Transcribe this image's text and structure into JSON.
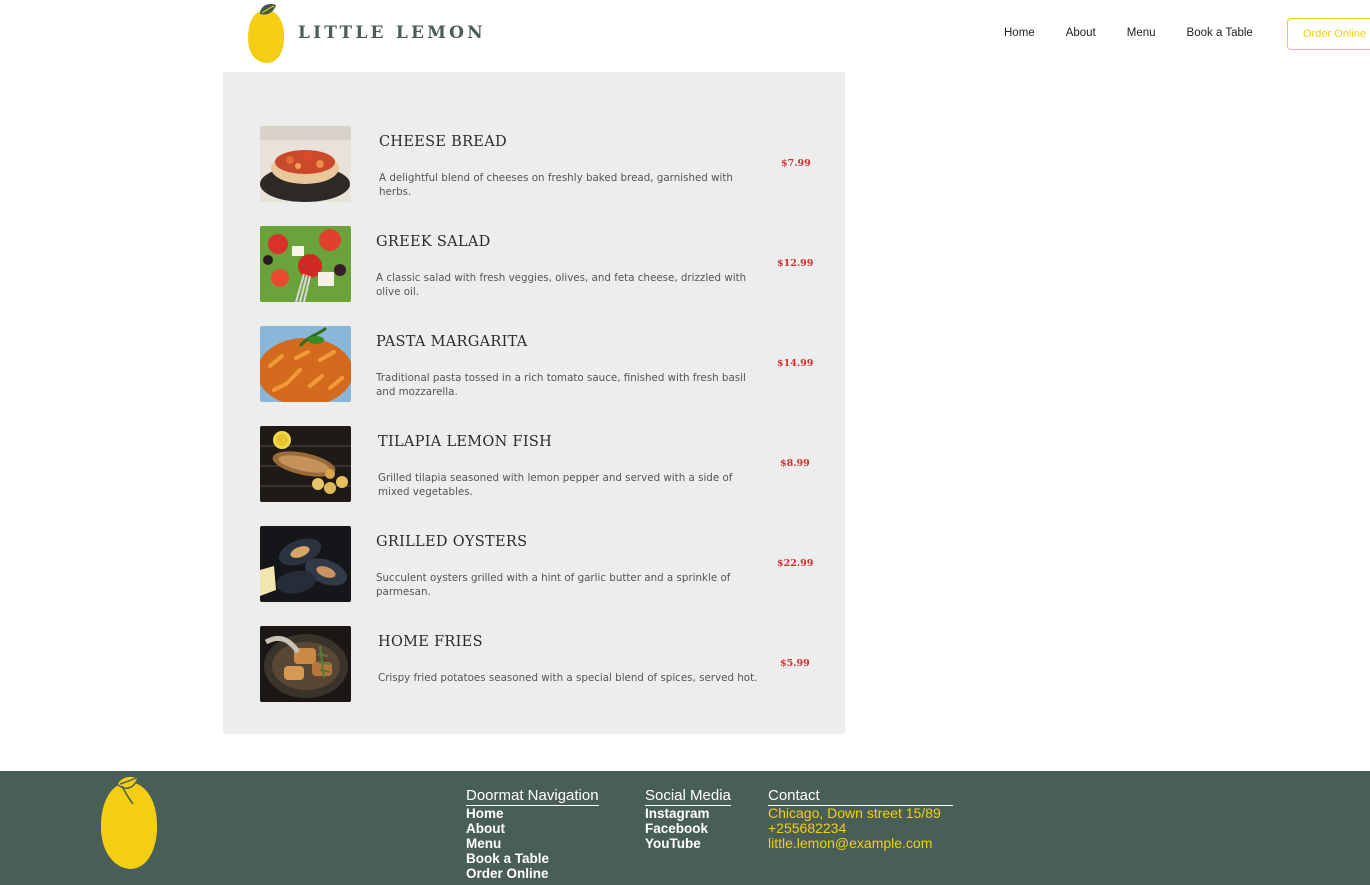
{
  "brand": {
    "name": "LITTLE LEMON",
    "accent": "#F4CE14",
    "primary": "#495E57",
    "price_color": "#D32F2F"
  },
  "nav": {
    "items": [
      "Home",
      "About",
      "Menu",
      "Book a Table"
    ],
    "order_label": "Order Online"
  },
  "menu": {
    "items": [
      {
        "name": "CHEESE BREAD",
        "description": "A delightful blend of cheeses on freshly baked bread, garnished with herbs.",
        "price": "$7.99",
        "image": "cheese-bread-photo"
      },
      {
        "name": "GREEK SALAD",
        "description": "A classic salad with fresh veggies, olives, and feta cheese, drizzled with olive oil.",
        "price": "$12.99",
        "image": "greek-salad-photo"
      },
      {
        "name": "PASTA MARGARITA",
        "description": "Traditional pasta tossed in a rich tomato sauce, finished with fresh basil and mozzarella.",
        "price": "$14.99",
        "image": "pasta-photo"
      },
      {
        "name": "TILAPIA LEMON FISH",
        "description": "Grilled tilapia seasoned with lemon pepper and served with a side of mixed vegetables.",
        "price": "$8.99",
        "image": "tilapia-photo"
      },
      {
        "name": "GRILLED OYSTERS",
        "description": "Succulent oysters grilled with a hint of garlic butter and a sprinkle of parmesan.",
        "price": "$22.99",
        "image": "oysters-photo"
      },
      {
        "name": "HOME FRIES",
        "description": "Crispy fried potatoes seasoned with a special blend of spices, served hot.",
        "price": "$5.99",
        "image": "home-fries-photo"
      }
    ]
  },
  "footer": {
    "doormat": {
      "title": "Doormat Navigation",
      "links": [
        "Home",
        "About",
        "Menu",
        "Book a Table",
        "Order Online"
      ]
    },
    "social": {
      "title": "Social Media",
      "links": [
        "Instagram",
        "Facebook",
        "YouTube"
      ]
    },
    "contact": {
      "title": "Contact",
      "lines": [
        "Chicago, Down street 15/89",
        "+255682234",
        "little.lemon@example.com"
      ]
    }
  }
}
